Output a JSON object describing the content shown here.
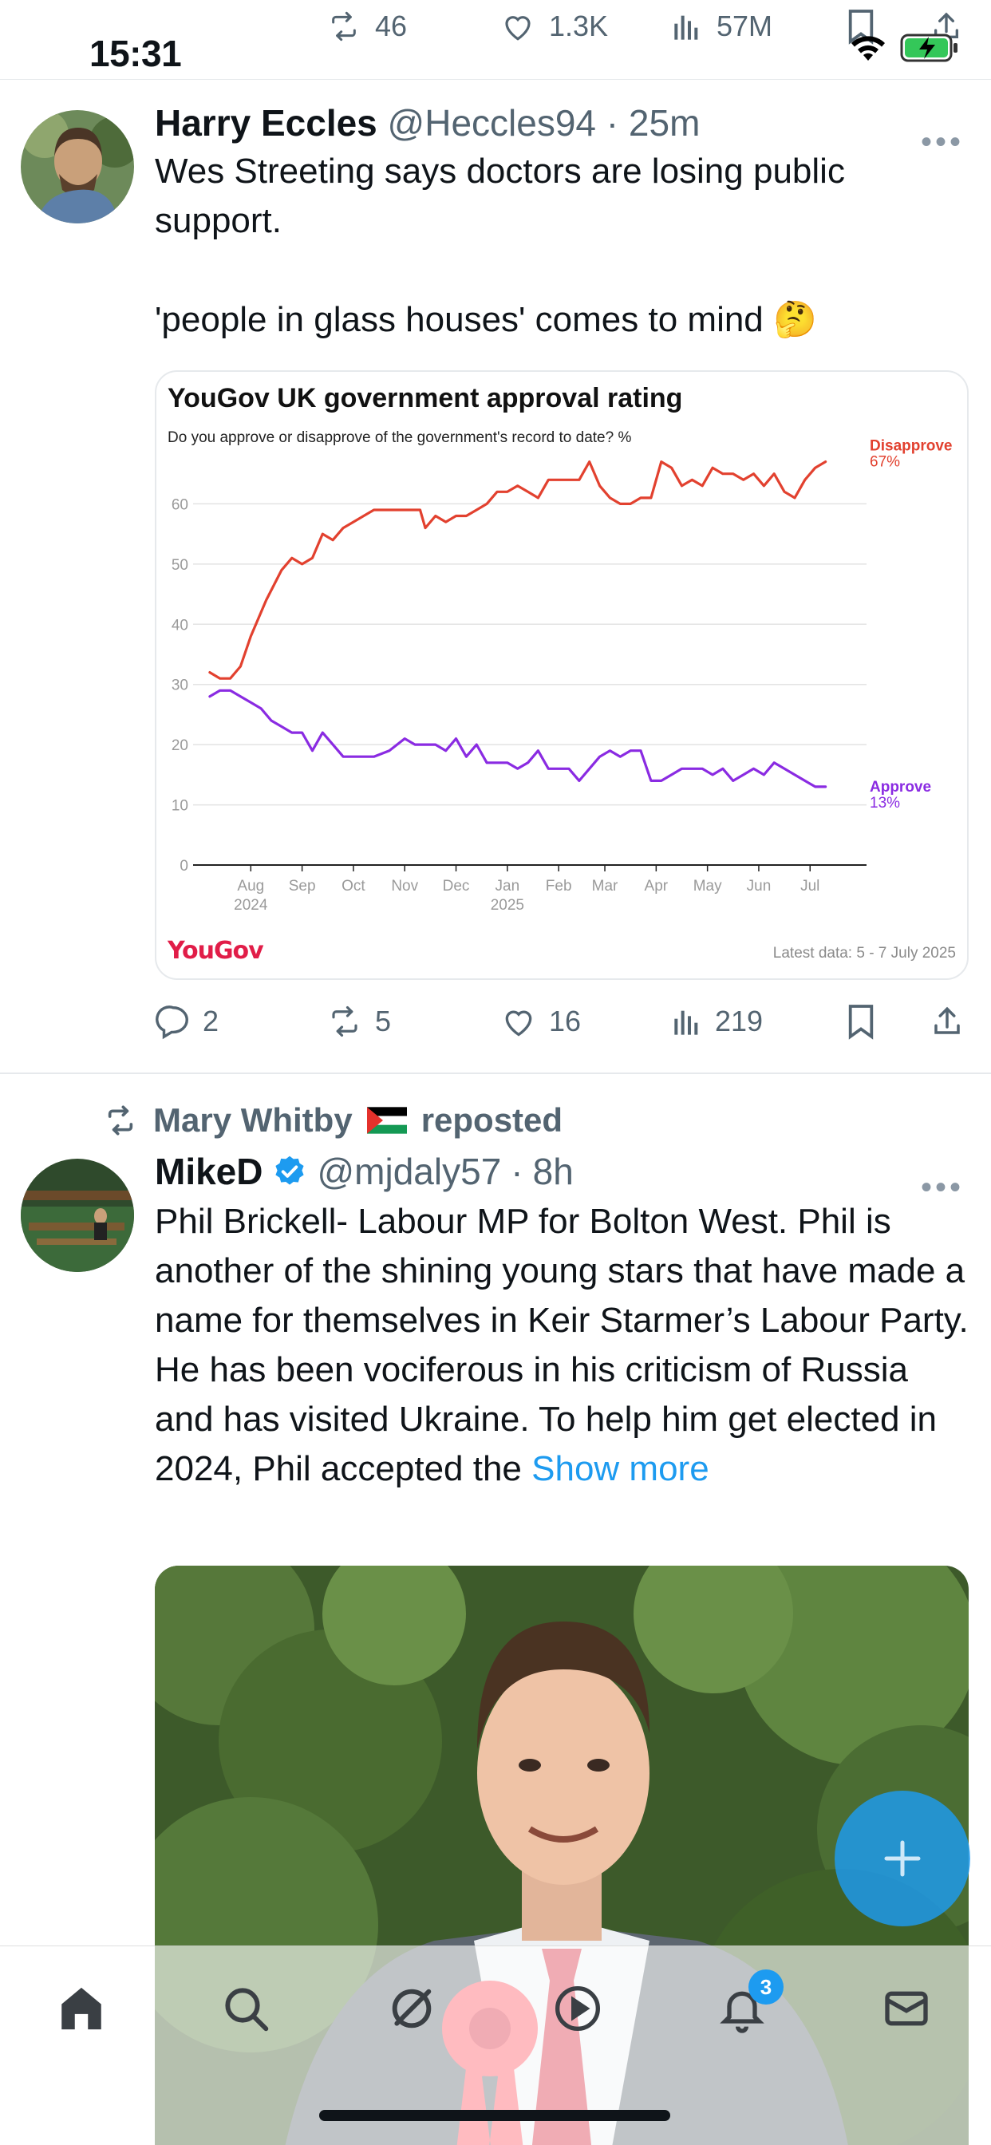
{
  "status_bar": {
    "time": "15:31"
  },
  "top_actions": {
    "retweets": "46",
    "likes": "1.3K",
    "views": "57M"
  },
  "tweet1": {
    "name": "Harry Eccles",
    "handle": "@Heccles94",
    "sep": "·",
    "time": "25m",
    "text": "Wes Streeting says doctors are losing public support.\n\n'people in glass houses' comes to mind 🤔",
    "replies": "2",
    "retweets": "5",
    "likes": "16",
    "views": "219"
  },
  "chart_card": {
    "brand": "YouGov",
    "latest": "Latest data: 5 - 7 July 2025"
  },
  "chart_data": {
    "type": "line",
    "title": "YouGov UK government approval rating",
    "subtitle": "Do you approve or disapprove of the government's record to date? %",
    "ylim": [
      0,
      70
    ],
    "yticks": [
      "0",
      "10",
      "20",
      "30",
      "40",
      "50",
      "60"
    ],
    "xticks": [
      {
        "label": "Aug",
        "sub": "2024",
        "t": 0.6
      },
      {
        "label": "Sep",
        "sub": "",
        "t": 1.6
      },
      {
        "label": "Oct",
        "sub": "",
        "t": 2.6
      },
      {
        "label": "Nov",
        "sub": "",
        "t": 3.6
      },
      {
        "label": "Dec",
        "sub": "",
        "t": 4.6
      },
      {
        "label": "Jan",
        "sub": "2025",
        "t": 5.6
      },
      {
        "label": "Feb",
        "sub": "",
        "t": 6.6
      },
      {
        "label": "Mar",
        "sub": "",
        "t": 7.5
      },
      {
        "label": "Apr",
        "sub": "",
        "t": 8.5
      },
      {
        "label": "May",
        "sub": "",
        "t": 9.5
      },
      {
        "label": "Jun",
        "sub": "",
        "t": 10.5
      },
      {
        "label": "Jul",
        "sub": "",
        "t": 11.5
      }
    ],
    "x_range_months": [
      -0.4,
      12.6
    ],
    "series": [
      {
        "name": "Disapprove",
        "end_label": "67%",
        "color": "#e2412f",
        "points": [
          [
            -0.2,
            32
          ],
          [
            0.0,
            31
          ],
          [
            0.2,
            31
          ],
          [
            0.4,
            33
          ],
          [
            0.6,
            38
          ],
          [
            0.9,
            44
          ],
          [
            1.2,
            49
          ],
          [
            1.4,
            51
          ],
          [
            1.6,
            50
          ],
          [
            1.8,
            51
          ],
          [
            2.0,
            55
          ],
          [
            2.2,
            54
          ],
          [
            2.4,
            56
          ],
          [
            2.6,
            57
          ],
          [
            2.8,
            58
          ],
          [
            3.0,
            59
          ],
          [
            3.3,
            59
          ],
          [
            3.6,
            59
          ],
          [
            3.9,
            59
          ],
          [
            4.0,
            56
          ],
          [
            4.2,
            58
          ],
          [
            4.4,
            57
          ],
          [
            4.6,
            58
          ],
          [
            4.8,
            58
          ],
          [
            5.0,
            59
          ],
          [
            5.2,
            60
          ],
          [
            5.4,
            62
          ],
          [
            5.6,
            62
          ],
          [
            5.8,
            63
          ],
          [
            6.0,
            62
          ],
          [
            6.2,
            61
          ],
          [
            6.4,
            64
          ],
          [
            6.6,
            64
          ],
          [
            6.8,
            64
          ],
          [
            7.0,
            64
          ],
          [
            7.2,
            67
          ],
          [
            7.4,
            63
          ],
          [
            7.6,
            61
          ],
          [
            7.8,
            60
          ],
          [
            8.0,
            60
          ],
          [
            8.2,
            61
          ],
          [
            8.4,
            61
          ],
          [
            8.6,
            67
          ],
          [
            8.8,
            66
          ],
          [
            9.0,
            63
          ],
          [
            9.2,
            64
          ],
          [
            9.4,
            63
          ],
          [
            9.6,
            66
          ],
          [
            9.8,
            65
          ],
          [
            10.0,
            65
          ],
          [
            10.2,
            64
          ],
          [
            10.4,
            65
          ],
          [
            10.6,
            63
          ],
          [
            10.8,
            65
          ],
          [
            11.0,
            62
          ],
          [
            11.2,
            61
          ],
          [
            11.4,
            64
          ],
          [
            11.6,
            66
          ],
          [
            11.8,
            67
          ]
        ]
      },
      {
        "name": "Approve",
        "end_label": "13%",
        "color": "#8a2be2",
        "points": [
          [
            -0.2,
            28
          ],
          [
            0.0,
            29
          ],
          [
            0.2,
            29
          ],
          [
            0.4,
            28
          ],
          [
            0.6,
            27
          ],
          [
            0.8,
            26
          ],
          [
            1.0,
            24
          ],
          [
            1.2,
            23
          ],
          [
            1.4,
            22
          ],
          [
            1.6,
            22
          ],
          [
            1.8,
            19
          ],
          [
            2.0,
            22
          ],
          [
            2.2,
            20
          ],
          [
            2.4,
            18
          ],
          [
            2.6,
            18
          ],
          [
            2.8,
            18
          ],
          [
            3.0,
            18
          ],
          [
            3.3,
            19
          ],
          [
            3.6,
            21
          ],
          [
            3.8,
            20
          ],
          [
            4.0,
            20
          ],
          [
            4.2,
            20
          ],
          [
            4.4,
            19
          ],
          [
            4.6,
            21
          ],
          [
            4.8,
            18
          ],
          [
            5.0,
            20
          ],
          [
            5.2,
            17
          ],
          [
            5.4,
            17
          ],
          [
            5.6,
            17
          ],
          [
            5.8,
            16
          ],
          [
            6.0,
            17
          ],
          [
            6.2,
            19
          ],
          [
            6.4,
            16
          ],
          [
            6.6,
            16
          ],
          [
            6.8,
            16
          ],
          [
            7.0,
            14
          ],
          [
            7.2,
            16
          ],
          [
            7.4,
            18
          ],
          [
            7.6,
            19
          ],
          [
            7.8,
            18
          ],
          [
            8.0,
            19
          ],
          [
            8.2,
            19
          ],
          [
            8.4,
            14
          ],
          [
            8.6,
            14
          ],
          [
            8.8,
            15
          ],
          [
            9.0,
            16
          ],
          [
            9.2,
            16
          ],
          [
            9.4,
            16
          ],
          [
            9.6,
            15
          ],
          [
            9.8,
            16
          ],
          [
            10.0,
            14
          ],
          [
            10.2,
            15
          ],
          [
            10.4,
            16
          ],
          [
            10.6,
            15
          ],
          [
            10.8,
            17
          ],
          [
            11.0,
            16
          ],
          [
            11.2,
            15
          ],
          [
            11.4,
            14
          ],
          [
            11.6,
            13
          ],
          [
            11.8,
            13
          ]
        ]
      }
    ]
  },
  "repost": {
    "by": "Mary Whitby",
    "suffix": "reposted"
  },
  "tweet2": {
    "name": "MikeD",
    "handle": "@mjdaly57",
    "sep": "·",
    "time": "8h",
    "text": "Phil Brickell- Labour MP for Bolton West. Phil is another of the shining young stars that have made a name for themselves in Keir Starmer’s Labour Party. He has been vociferous in his criticism of Russia and has visited Ukraine. To help him get elected in 2024, Phil accepted the ",
    "show_more": "Show more"
  },
  "nav": {
    "notification_count": "3"
  },
  "colors": {
    "accent": "#1d9bf0",
    "muted": "#536471",
    "disapprove": "#e2412f",
    "approve": "#8a2be2"
  }
}
